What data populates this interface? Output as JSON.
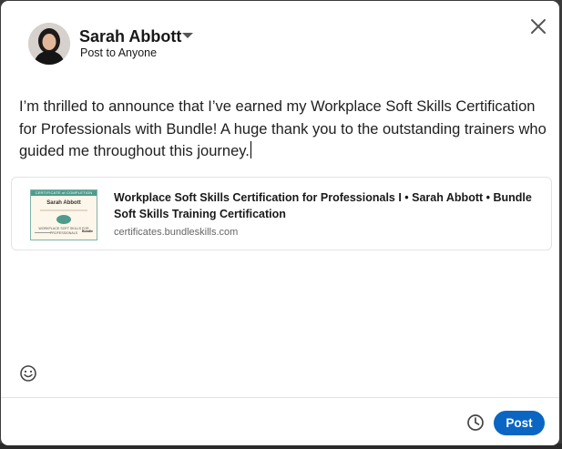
{
  "author": {
    "name": "Sarah Abbott",
    "visibility": "Post to Anyone"
  },
  "post": {
    "text": "I’m thrilled to announce that I’ve earned my Workplace Soft Skills Certification for Professionals with Bundle! A huge thank you to the outstanding trainers who guided me throughout this journey."
  },
  "preview": {
    "title": "Workplace Soft Skills Certification for Professionals I • Sarah Abbott • Bundle Soft Skills Training Certification",
    "url": "certificates.bundleskills.com",
    "thumbnail": {
      "header": "CERTIFICATE of COMPLETION",
      "name": "Sarah Abbott",
      "course": "WORKPLACE SOFT SKILLS FOR PROFESSIONALS",
      "brand": "Bundle"
    }
  },
  "actions": {
    "post_label": "Post"
  },
  "icons": {
    "close": "close-icon",
    "caret": "caret-down-icon",
    "emoji": "smiley-icon",
    "schedule": "clock-icon"
  },
  "colors": {
    "primary": "#0a66c2",
    "text": "#191919"
  }
}
